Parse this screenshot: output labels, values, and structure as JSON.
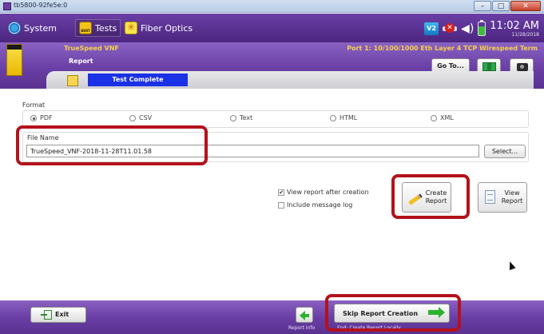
{
  "window": {
    "title": "tb5800-92fe5e:0"
  },
  "menu": {
    "system": "System",
    "tests": "Tests",
    "fiber": "Fiber Optics"
  },
  "status": {
    "v2_badge": "V2",
    "time": "11:02 AM",
    "date": "11/28/2018"
  },
  "module": {
    "name": "TrueSpeed VNF",
    "screen": "Report",
    "port_info": "Port 1: 10/100/1000 Eth Layer 4 TCP Wirespeed Term",
    "goto_label": "Go To...",
    "test_status": "Test Complete"
  },
  "format": {
    "label": "Format",
    "options": [
      "PDF",
      "CSV",
      "Text",
      "HTML",
      "XML"
    ],
    "selected": "PDF"
  },
  "file": {
    "label": "File Name",
    "value": "TrueSpeed_VNF-2018-11-28T11.01.58",
    "select_label": "Select..."
  },
  "options": {
    "view_after": {
      "label": "View report after creation",
      "checked": true
    },
    "include_log": {
      "label": "Include message log",
      "checked": false
    }
  },
  "actions": {
    "create_line1": "Create",
    "create_line2": "Report",
    "view_line1": "View",
    "view_line2": "Report"
  },
  "bottom": {
    "exit_label": "Exit",
    "report_info_caption": "Report Info",
    "skip_label": "Skip Report Creation",
    "skip_caption": "End: Create Report Locally"
  },
  "colors": {
    "brand_purple": "#6a3fa6",
    "accent_yellow": "#f6d24a",
    "status_blue": "#1b31e6",
    "highlight_red": "#b3121b"
  },
  "icons": {
    "system": "system-gear-icon",
    "tests": "bert-icon",
    "fiber": "fiber-star-icon",
    "create": "pencil-icon",
    "view": "document-icon",
    "exit": "exit-door-icon",
    "report_info": "left-arrow-icon",
    "skip": "right-arrow-icon"
  }
}
